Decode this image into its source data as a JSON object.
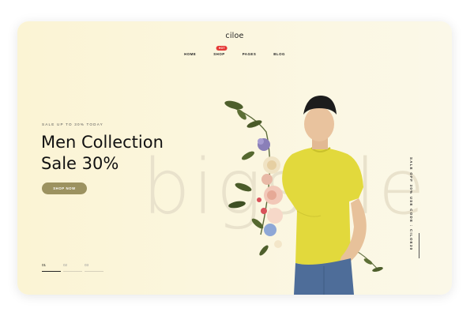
{
  "brand": {
    "logo": "ciloe"
  },
  "nav": {
    "items": [
      {
        "label": "HOME"
      },
      {
        "label": "SHOP",
        "badge": "HOT"
      },
      {
        "label": "PAGES"
      },
      {
        "label": "BLOG"
      }
    ]
  },
  "hero": {
    "eyebrow": "SALE UP TO 30% TODAY",
    "title_line1": "Men Collection",
    "title_line2": "Sale 30%",
    "cta": "SHOP NOW",
    "background_text": "bigsale",
    "side_text": "SALE OFF 30% USE CODE : CILOE30"
  },
  "pager": {
    "items": [
      "01",
      "02",
      "03"
    ],
    "active_index": 0
  },
  "colors": {
    "background": "#fbf5da",
    "button": "#9c9260",
    "badge": "#e53935",
    "shirt": "#e2d93c",
    "jeans": "#4e6d99"
  },
  "icons": [
    "model-with-flowers-image"
  ]
}
